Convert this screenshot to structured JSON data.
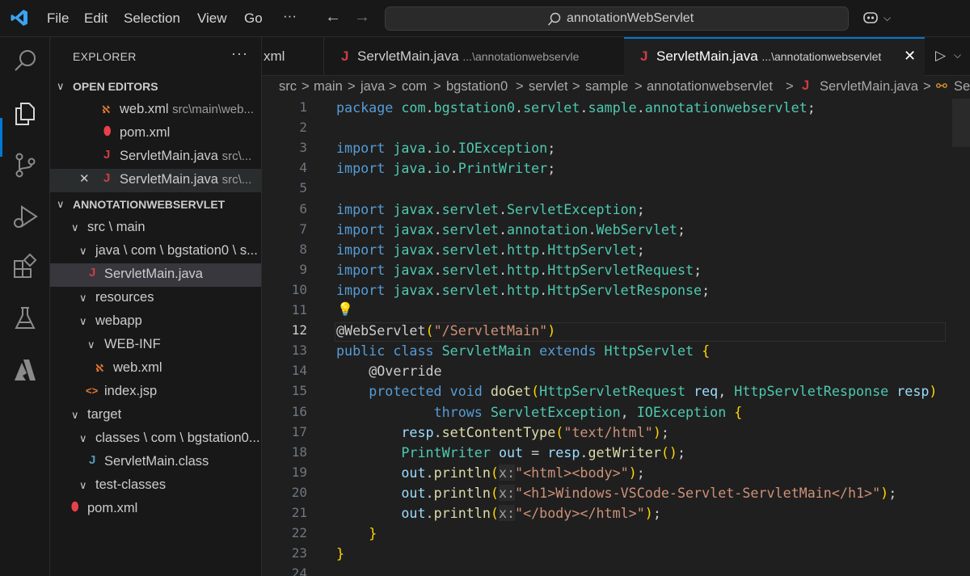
{
  "menu": [
    "File",
    "Edit",
    "Selection",
    "View",
    "Go",
    "···"
  ],
  "search": {
    "text": "annotationWebServlet"
  },
  "sidebar": {
    "title": "EXPLORER",
    "dots": "···",
    "open_editors_label": "OPEN EDITORS",
    "open_editors": [
      {
        "name": "web.xml",
        "desc": "src\\main\\web..."
      },
      {
        "name": "pom.xml",
        "desc": ""
      },
      {
        "name": "ServletMain.java",
        "desc": "src\\..."
      },
      {
        "name": "ServletMain.java",
        "desc": "src\\..."
      }
    ],
    "project_label": "ANNOTATIONWEBSERVLET",
    "tree": [
      "src \\ main",
      "java \\ com \\ bgstation0 \\ s...",
      "ServletMain.java",
      "resources",
      "webapp",
      "WEB-INF",
      "web.xml",
      "index.jsp",
      "target",
      "classes \\ com \\ bgstation0...",
      "ServletMain.class",
      "test-classes",
      "pom.xml"
    ]
  },
  "tabs": [
    {
      "name": "xml",
      "desc": ""
    },
    {
      "name": "ServletMain.java",
      "desc": "...\\annotationwebservle"
    },
    {
      "name": "ServletMain.java",
      "desc": "...\\annotationwebservlet"
    }
  ],
  "breadcrumb": [
    "src",
    "main",
    "java",
    "com",
    "bgstation0",
    "servlet",
    "sample",
    "annotationwebservlet",
    "ServletMain.java",
    "Se"
  ],
  "editor": {
    "line_numbers": [
      "1",
      "2",
      "3",
      "4",
      "5",
      "6",
      "7",
      "8",
      "9",
      "10",
      "11",
      "12",
      "13",
      "14",
      "15",
      "16",
      "17",
      "18",
      "19",
      "20",
      "21",
      "22",
      "23",
      "24"
    ],
    "current_line": "12",
    "lines": [
      "package com.bgstation0.servlet.sample.annotationwebservlet;",
      "",
      "import java.io.IOException;",
      "import java.io.PrintWriter;",
      "",
      "import javax.servlet.ServletException;",
      "import javax.servlet.annotation.WebServlet;",
      "import javax.servlet.http.HttpServlet;",
      "import javax.servlet.http.HttpServletRequest;",
      "import javax.servlet.http.HttpServletResponse;",
      "",
      "@WebServlet(\"/ServletMain\")",
      "public class ServletMain extends HttpServlet {",
      "    @Override",
      "    protected void doGet(HttpServletRequest req, HttpServletResponse resp)",
      "            throws ServletException, IOException {",
      "        resp.setContentType(\"text/html\");",
      "        PrintWriter out = resp.getWriter();",
      "        out.println(x:\"<html><body>\");",
      "        out.println(x:\"<h1>Windows-VSCode-Servlet-ServletMain</h1>\");",
      "        out.println(x:\"</body></html>\");",
      "    }",
      "}",
      ""
    ]
  }
}
